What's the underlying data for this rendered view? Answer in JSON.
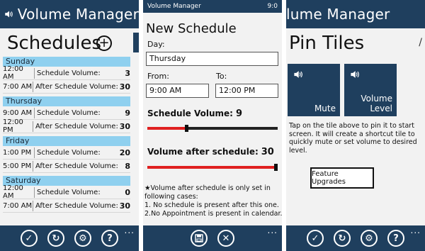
{
  "colors": {
    "header": "#1f3f5e",
    "day_header": "#8fd0ef",
    "slider_fill": "#e02020",
    "slider_rest": "#222222",
    "background": "#f2f2f2"
  },
  "panel1": {
    "app_title": "Volume Manager",
    "page_title": "Schedules",
    "add_icon": "plus-circle-icon",
    "days": [
      {
        "name": "Sunday",
        "rows": [
          {
            "time": "12:00 AM",
            "label": "Schedule Volume:",
            "value": "3"
          },
          {
            "time": "7:00 AM",
            "label": "After Schedule Volume:",
            "value": "30"
          }
        ]
      },
      {
        "name": "Thursday",
        "rows": [
          {
            "time": "9:00 AM",
            "label": "Schedule Volume:",
            "value": "9"
          },
          {
            "time": "12:00 PM",
            "label": "After Schedule Volume:",
            "value": "30"
          }
        ]
      },
      {
        "name": "Friday",
        "rows": [
          {
            "time": "1:00 PM",
            "label": "Schedule Volume:",
            "value": "20"
          },
          {
            "time": "5:00 PM",
            "label": "After Schedule Volume:",
            "value": "8"
          }
        ]
      },
      {
        "name": "Saturday",
        "rows": [
          {
            "time": "12:00 AM",
            "label": "Schedule Volume:",
            "value": "0"
          },
          {
            "time": "7:00 AM",
            "label": "After Schedule Volume:",
            "value": "30"
          }
        ]
      }
    ],
    "appbar_icons": [
      "check-icon",
      "sync-icon",
      "settings-icon",
      "help-icon"
    ],
    "more": "..."
  },
  "panel2": {
    "status_left": "Volume Manager",
    "status_right": "9:0",
    "page_title": "New Schedule",
    "day_label": "Day:",
    "day_value": "Thursday",
    "from_label": "From:",
    "from_value": "9:00 AM",
    "to_label": "To:",
    "to_value": "12:00 PM",
    "schedule_volume_label": "Schedule Volume:",
    "schedule_volume_value": "9",
    "schedule_volume_fraction": 0.3,
    "after_volume_label": "Volume after schedule:",
    "after_volume_value": "30",
    "after_volume_fraction": 1.0,
    "note_lines": [
      "★Volume after schedule is only set in",
      "following cases:",
      "1. No schedule is present after this one.",
      "2.No Appointment is present in calendar."
    ],
    "appbar_icons": [
      "save-icon",
      "cancel-icon"
    ],
    "more": "..."
  },
  "panel3": {
    "app_title": "lume Manager",
    "page_title": "Pin Tiles",
    "tiles": [
      {
        "icon": "speaker-icon",
        "label": "Mute"
      },
      {
        "icon": "speaker-icon",
        "label_line1": "Volume",
        "label_line2": "Level"
      }
    ],
    "pin_text": "Tap on the tile above to pin it to start screen. It will create a shortcut tile to quickly mute or set volume to desired level.",
    "feature_button": "Feature Upgrades",
    "appbar_icons": [
      "check-icon",
      "sync-icon",
      "settings-icon",
      "help-icon"
    ],
    "more": "..."
  }
}
